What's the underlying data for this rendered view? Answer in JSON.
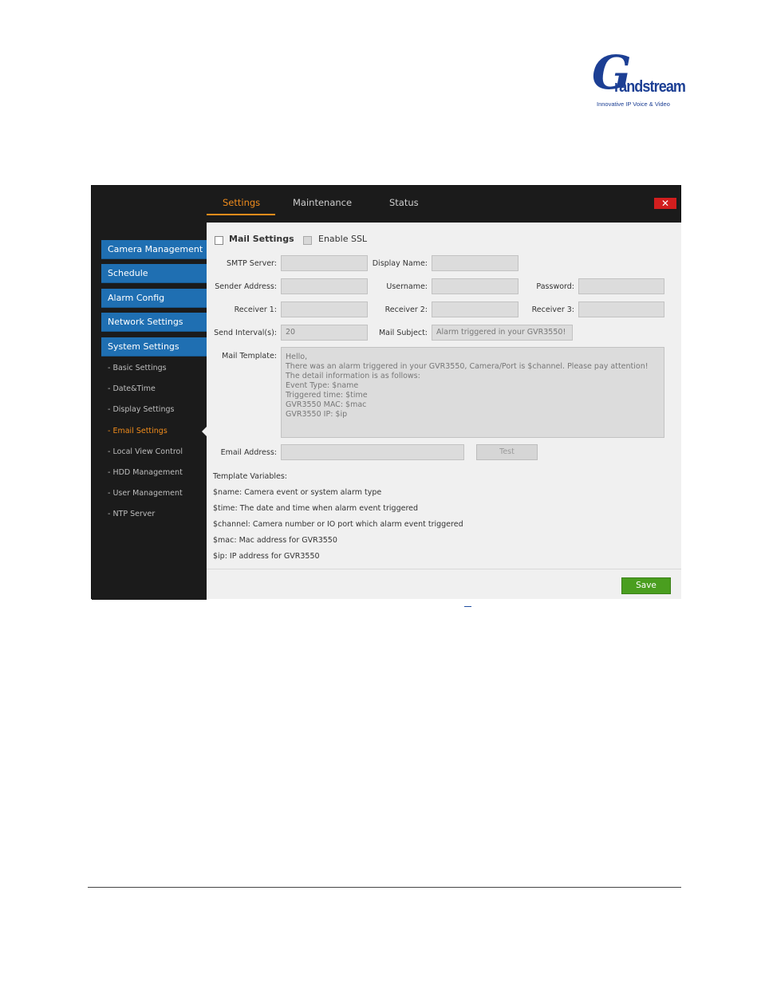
{
  "logo": {
    "mark": "G",
    "brand": "randstream",
    "tagline": "Innovative IP Voice & Video"
  },
  "tabs": [
    {
      "label": "Settings",
      "active": true
    },
    {
      "label": "Maintenance",
      "active": false
    },
    {
      "label": "Status",
      "active": false
    }
  ],
  "close_label": "✕",
  "sidebar": {
    "main_items": [
      "Camera Management",
      "Schedule",
      "Alarm Config",
      "Network Settings",
      "System Settings"
    ],
    "sub_items": [
      "- Basic Settings",
      "- Date&Time",
      "- Display Settings",
      "- Email Settings",
      "- Local View Control",
      "- HDD Management",
      "- User Management",
      "- NTP Server"
    ],
    "active_sub": "- Email Settings"
  },
  "form": {
    "mail_settings_label": "Mail Settings",
    "enable_ssl_label": "Enable SSL",
    "smtp_server_label": "SMTP Server:",
    "display_name_label": "Display Name:",
    "sender_address_label": "Sender Address:",
    "username_label": "Username:",
    "password_label": "Password:",
    "receiver1_label": "Receiver 1:",
    "receiver2_label": "Receiver 2:",
    "receiver3_label": "Receiver 3:",
    "send_interval_label": "Send Interval(s):",
    "send_interval_value": "20",
    "mail_subject_label": "Mail Subject:",
    "mail_subject_value": "Alarm triggered in your GVR3550!",
    "mail_template_label": "Mail Template:",
    "mail_template_lines": [
      "Hello,",
      "There was an alarm triggered in your GVR3550, Camera/Port is $channel. Please pay attention!",
      "The detail information is as follows:",
      "Event Type: $name",
      "Triggered time: $time",
      "GVR3550 MAC: $mac",
      "GVR3550 IP: $ip"
    ],
    "email_address_label": "Email Address:",
    "test_label": "Test"
  },
  "template_variables": {
    "heading": "Template Variables:",
    "lines": [
      "$name: Camera event or system alarm type",
      "$time: The date and time when alarm event triggered",
      "$channel: Camera number or IO port which alarm event triggered",
      "$mac: Mac address for GVR3550",
      "$ip: IP address for GVR3550"
    ]
  },
  "save_label": "Save",
  "colors": {
    "accent": "#f08c1c",
    "menu_blue": "#1f6fb2",
    "save_green": "#4a9e1f",
    "close_red": "#d21e1e"
  }
}
